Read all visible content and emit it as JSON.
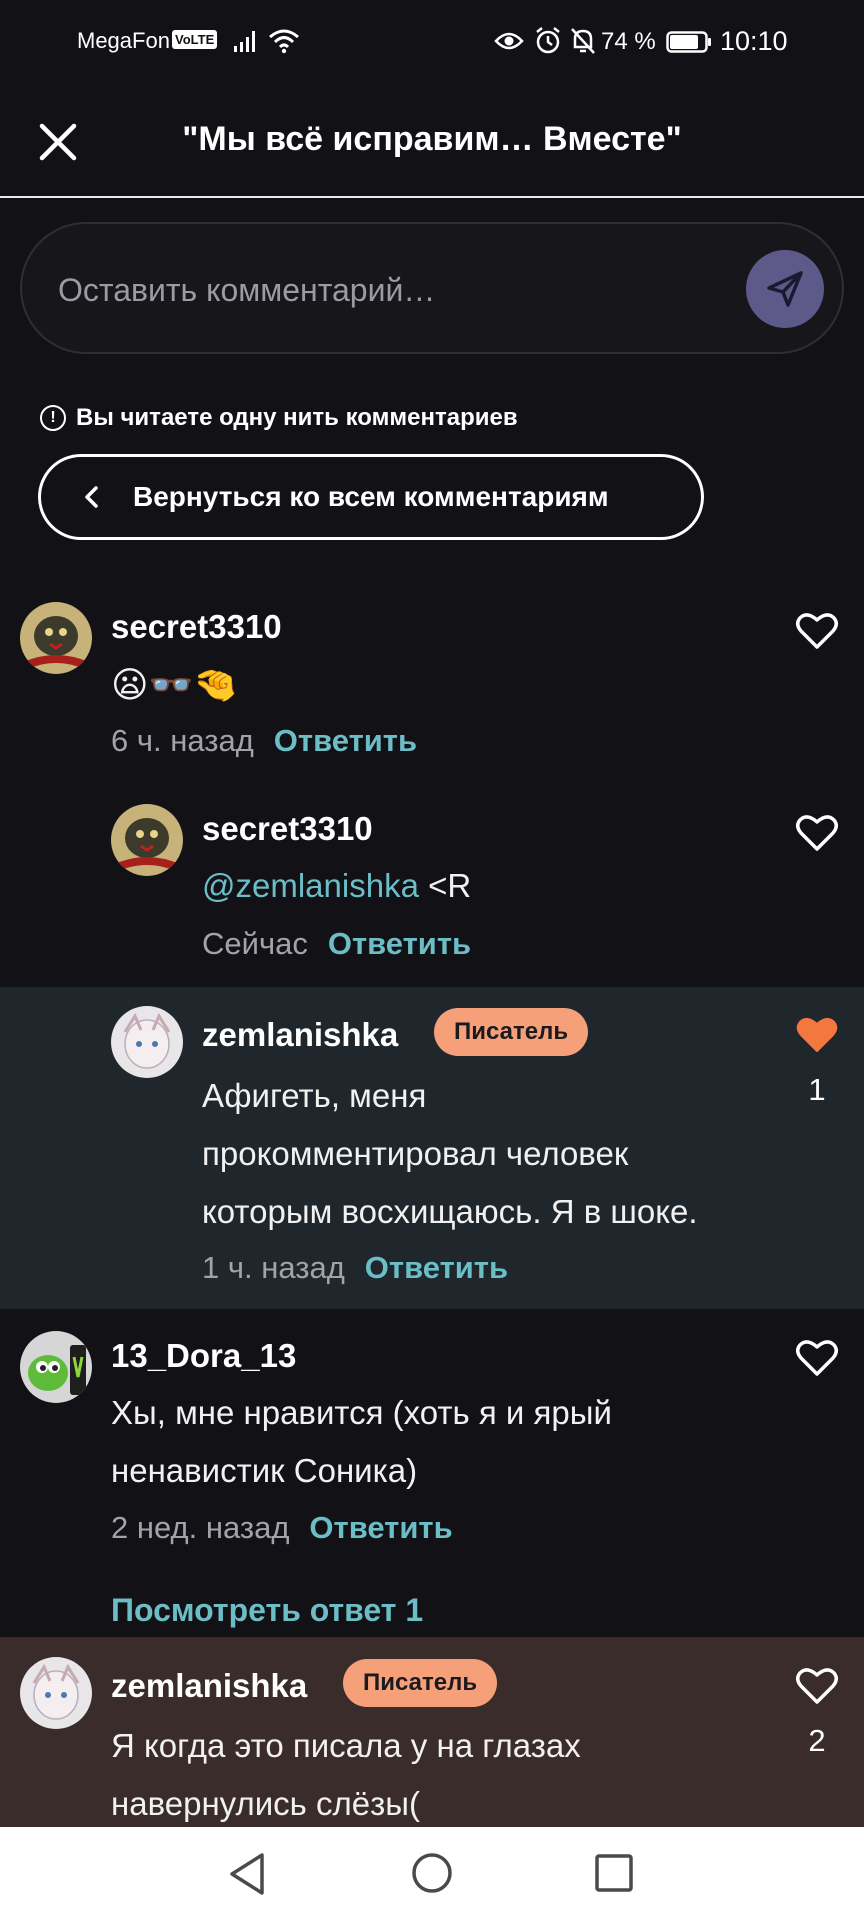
{
  "status_bar": {
    "carrier": "MegaFon",
    "volte": "VoLTE",
    "battery": "74 %",
    "time": "10:10",
    "icons": [
      "signal-icon",
      "wifi-icon",
      "eye-icon",
      "alarm-icon",
      "mute-icon",
      "battery-icon"
    ]
  },
  "header": {
    "title": "\"Мы всё исправим… Вместе\"",
    "close_icon": "close-icon"
  },
  "comment_input": {
    "placeholder": "Оставить комментарий…",
    "send_icon": "send-icon"
  },
  "thread_notice": {
    "text": "Вы читаете одну нить комментариев",
    "back_label": "Вернуться ко всем комментариям"
  },
  "comments": [
    {
      "username": "secret3310",
      "text": "😦👓🤏",
      "time": "6 ч. назад",
      "reply": "Ответить",
      "liked": false,
      "likes": ""
    },
    {
      "username": "secret3310",
      "mention": "@zemlanishka",
      "text": " <R",
      "time": "Сейчас",
      "reply": "Ответить",
      "liked": false,
      "likes": ""
    },
    {
      "username": "zemlanishka",
      "badge": "Писатель",
      "text_lines": [
        "Афигеть, меня",
        "прокомментировал человек",
        "которым восхищаюсь. Я в шоке."
      ],
      "time": "1 ч. назад",
      "reply": "Ответить",
      "liked": true,
      "likes": "1"
    },
    {
      "username": "13_Dora_13",
      "text_lines": [
        "Хы, мне нравится (хоть я и ярый",
        "ненавистик Соника)"
      ],
      "time": "2 нед. назад",
      "reply": "Ответить",
      "liked": false,
      "likes": "",
      "view_replies": "Посмотреть ответ 1"
    },
    {
      "username": "zemlanishka",
      "badge": "Писатель",
      "text_lines": [
        "Я когда это писала у на глазах",
        "навернулись слёзы("
      ],
      "liked": false,
      "likes": "2"
    }
  ],
  "colors": {
    "background": "#121116",
    "accent_teal": "#6bbdc6",
    "badge": "#f6a07a",
    "liked_heart": "#f2783f",
    "highlight_gray": "#1f272c",
    "highlight_brown": "#3a2c2a"
  }
}
